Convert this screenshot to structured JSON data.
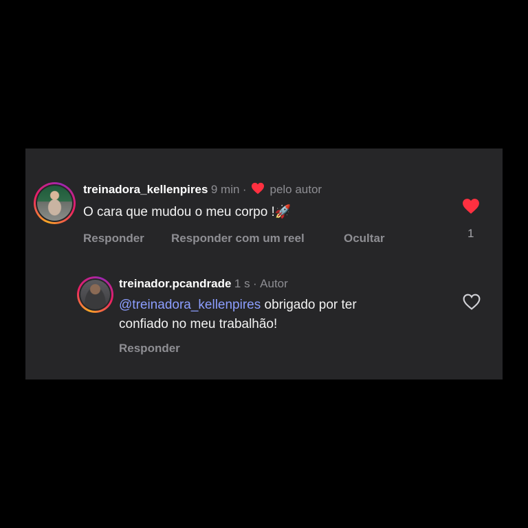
{
  "comment": {
    "username": "treinadora_kellenpires",
    "time": "9 min",
    "separator": "·",
    "liked_by_author_label": "pelo autor",
    "text": "O cara que mudou o meu corpo !🚀",
    "actions": {
      "reply": "Responder",
      "reply_reel": "Responder com um reel",
      "hide": "Ocultar"
    },
    "like_count": "1",
    "liked": true
  },
  "reply": {
    "username": "treinador.pcandrade",
    "time": "1 s",
    "separator": "·",
    "author_label": "Autor",
    "mention": "@treinadora_kellenpires",
    "text_line1": " obrigado por ter",
    "text_line2": "confiado no meu trabalhão!",
    "actions": {
      "reply": "Responder"
    },
    "liked": false
  },
  "colors": {
    "background": "#000000",
    "card": "#262628",
    "heart_red": "#ff3040",
    "mention": "#8c9eff",
    "muted": "#8e8e93"
  }
}
